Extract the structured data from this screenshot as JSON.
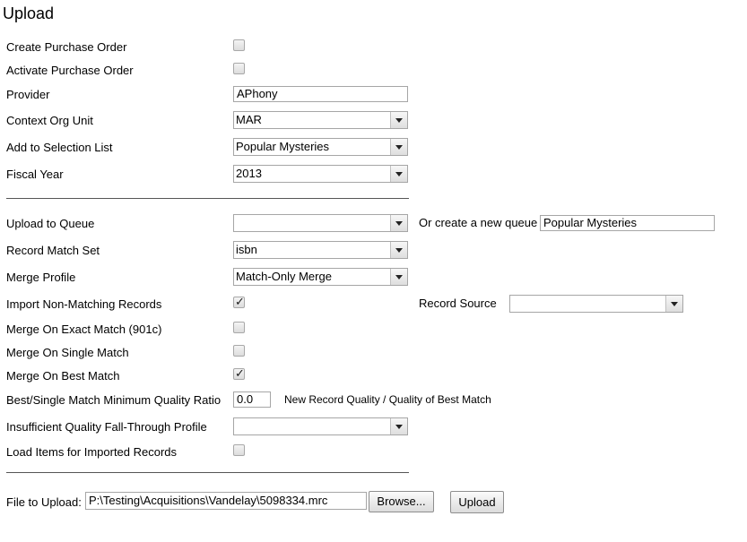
{
  "page": {
    "title": "Upload"
  },
  "fields": {
    "create_po": {
      "label": "Create Purchase Order",
      "checked": false
    },
    "activate_po": {
      "label": "Activate Purchase Order",
      "checked": false
    },
    "provider": {
      "label": "Provider",
      "value": "APhony"
    },
    "context_org_unit": {
      "label": "Context Org Unit",
      "value": "MAR"
    },
    "selection_list": {
      "label": "Add to Selection List",
      "value": "Popular Mysteries"
    },
    "fiscal_year": {
      "label": "Fiscal Year",
      "value": "2013"
    },
    "upload_queue": {
      "label": "Upload to Queue",
      "value": ""
    },
    "new_queue": {
      "label": "Or create a new queue",
      "value": "Popular Mysteries"
    },
    "record_match_set": {
      "label": "Record Match Set",
      "value": "isbn"
    },
    "merge_profile": {
      "label": "Merge Profile",
      "value": "Match-Only Merge"
    },
    "import_non_matching": {
      "label": "Import Non-Matching Records",
      "checked": true
    },
    "record_source": {
      "label": "Record Source",
      "value": ""
    },
    "merge_exact": {
      "label": "Merge On Exact Match (901c)",
      "checked": false
    },
    "merge_single": {
      "label": "Merge On Single Match",
      "checked": false
    },
    "merge_best": {
      "label": "Merge On Best Match",
      "checked": true
    },
    "min_quality": {
      "label": "Best/Single Match Minimum Quality Ratio",
      "value": "0.0",
      "hint": "New Record Quality / Quality of Best Match"
    },
    "fallthrough": {
      "label": "Insufficient Quality Fall-Through Profile",
      "value": ""
    },
    "load_items": {
      "label": "Load Items for Imported Records",
      "checked": false
    },
    "file": {
      "label": "File to Upload:",
      "value": "P:\\Testing\\Acquisitions\\Vandelay\\5098334.mrc",
      "browse_label": "Browse..."
    }
  },
  "actions": {
    "upload_label": "Upload"
  },
  "icons": {
    "checked": "checkmark-icon",
    "dropdown": "chevron-down-icon"
  }
}
